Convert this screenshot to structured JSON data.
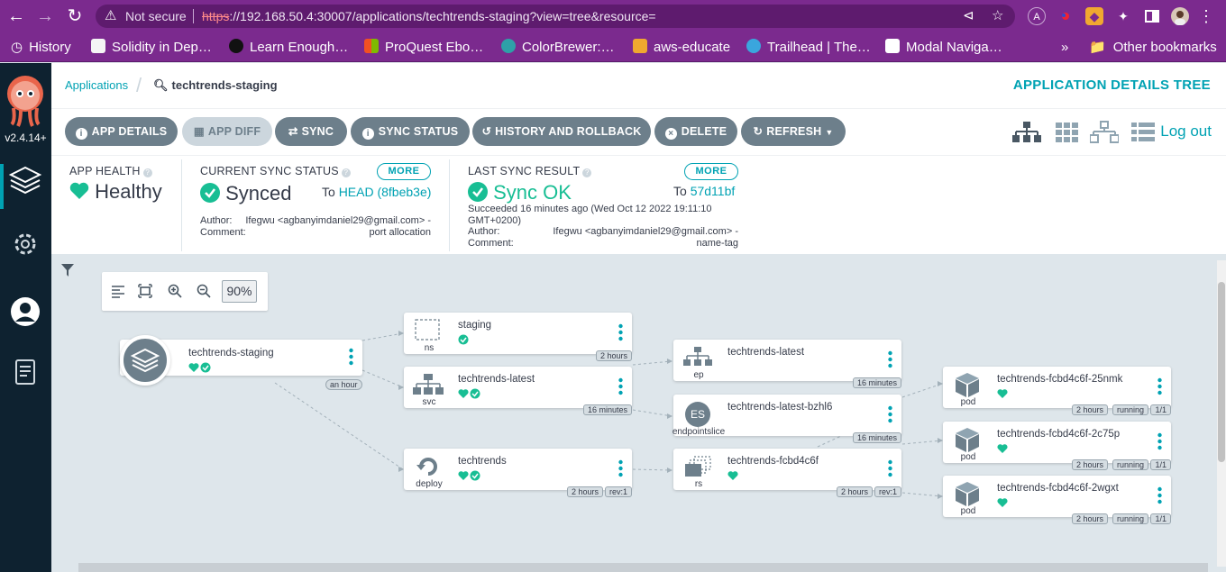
{
  "browser": {
    "security_label": "Not secure",
    "url_scheme": "https",
    "url_rest": "://192.168.50.4:30007/applications/techtrends-staging?view=tree&resource=",
    "bookmarks": [
      {
        "label": "History",
        "color": "#ffffff"
      },
      {
        "label": "Solidity in Dep…",
        "color": "#ffffff"
      },
      {
        "label": "Learn Enough…",
        "color": "#111111"
      },
      {
        "label": "ProQuest Ebo…",
        "color": "#f25022"
      },
      {
        "label": "ColorBrewer:…",
        "color": "#2ea0a8"
      },
      {
        "label": "aws-educate",
        "color": "#f0a830"
      },
      {
        "label": "Trailhead | The…",
        "color": "#3aa6dd"
      },
      {
        "label": "Modal Naviga…",
        "color": "#ffffff"
      }
    ],
    "overflow": "»",
    "other_bookmarks": "Other bookmarks"
  },
  "sidebar": {
    "version": "v2.4.14+"
  },
  "header": {
    "breadcrumb_root": "Applications",
    "breadcrumb_current": "techtrends-staging",
    "title": "APPLICATION DETAILS TREE"
  },
  "toolbar": {
    "app_details": "APP DETAILS",
    "app_diff": "APP DIFF",
    "sync": "SYNC",
    "sync_status": "SYNC STATUS",
    "history": "HISTORY AND ROLLBACK",
    "delete": "DELETE",
    "refresh": "REFRESH",
    "logout": "Log out"
  },
  "status": {
    "health_label": "APP HEALTH",
    "health_value": "Healthy",
    "sync_label": "CURRENT SYNC STATUS",
    "sync_value": "Synced",
    "sync_more": "MORE",
    "sync_to": "To",
    "sync_target": "HEAD (8fbeb3e)",
    "sync_author_key": "Author:",
    "sync_author_val": "Ifegwu <agbanyimdaniel29@gmail.com> -",
    "sync_comment_key": "Comment:",
    "sync_comment_val": "port allocation",
    "last_label": "LAST SYNC RESULT",
    "last_value": "Sync OK",
    "last_more": "MORE",
    "last_to": "To",
    "last_target": "57d11bf",
    "last_succeeded_1": "Succeeded 16 minutes ago (Wed Oct 12 2022 19:11:10",
    "last_succeeded_2": "GMT+0200)",
    "last_author_key": "Author:",
    "last_author_val": "Ifegwu <agbanyimdaniel29@gmail.com> -",
    "last_comment_key": "Comment:",
    "last_comment_val": "name-tag",
    "healthy_color": "#18be94"
  },
  "canvas": {
    "zoom": "90%"
  },
  "tree": {
    "root": {
      "name": "techtrends-staging",
      "age": "an hour"
    },
    "ns": {
      "name": "staging",
      "kind": "ns",
      "age": "2 hours"
    },
    "svc": {
      "name": "techtrends-latest",
      "kind": "svc",
      "age": "16 minutes"
    },
    "deploy": {
      "name": "techtrends",
      "kind": "deploy",
      "age": "2 hours",
      "rev": "rev:1"
    },
    "ep": {
      "name": "techtrends-latest",
      "kind": "ep",
      "age": "16 minutes"
    },
    "es": {
      "name": "techtrends-latest-bzhl6",
      "kind": "endpointslice",
      "icon_text": "ES",
      "age": "16 minutes"
    },
    "rs": {
      "name": "techtrends-fcbd4c6f",
      "kind": "rs",
      "age": "2 hours",
      "rev": "rev:1"
    },
    "pods": [
      {
        "name": "techtrends-fcbd4c6f-25nmk",
        "kind": "pod",
        "age": "2 hours",
        "state": "running",
        "ready": "1/1"
      },
      {
        "name": "techtrends-fcbd4c6f-2c75p",
        "kind": "pod",
        "age": "2 hours",
        "state": "running",
        "ready": "1/1"
      },
      {
        "name": "techtrends-fcbd4c6f-2wgxt",
        "kind": "pod",
        "age": "2 hours",
        "state": "running",
        "ready": "1/1"
      }
    ]
  }
}
